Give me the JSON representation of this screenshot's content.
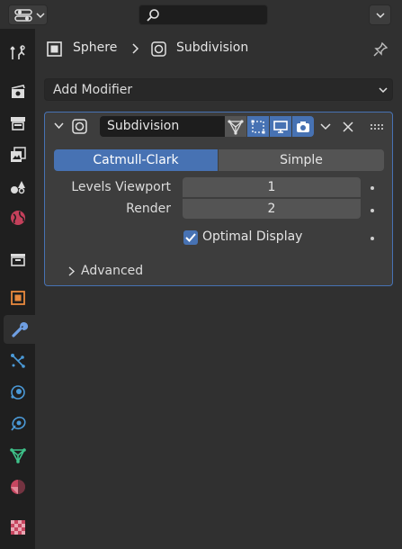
{
  "header": {
    "search_placeholder": ""
  },
  "breadcrumb": {
    "object": "Sphere",
    "modifier": "Subdivision"
  },
  "add_modifier": {
    "label": "Add Modifier"
  },
  "modifier": {
    "name": "Subdivision",
    "type_options": [
      "Catmull-Clark",
      "Simple"
    ],
    "selected_type": "Catmull-Clark",
    "levels_viewport_label": "Levels Viewport",
    "levels_viewport": "1",
    "render_label": "Render",
    "render": "2",
    "optimal_display_label": "Optimal Display",
    "optimal_display": true,
    "advanced_label": "Advanced"
  },
  "colors": {
    "accent": "#4772b3",
    "background": "#303030",
    "tab_bar": "#1f1f1f"
  },
  "tabs": [
    {
      "name": "tool",
      "icon": "tool-icon"
    },
    {
      "name": "render",
      "icon": "render-icon"
    },
    {
      "name": "output",
      "icon": "output-icon"
    },
    {
      "name": "view-layer",
      "icon": "view-layer-icon"
    },
    {
      "name": "scene",
      "icon": "scene-icon"
    },
    {
      "name": "world",
      "icon": "world-icon"
    },
    {
      "name": "collection",
      "icon": "collection-icon"
    },
    {
      "name": "object",
      "icon": "object-icon"
    },
    {
      "name": "modifiers",
      "icon": "wrench-icon",
      "active": true
    },
    {
      "name": "particles",
      "icon": "particles-icon"
    },
    {
      "name": "physics",
      "icon": "physics-icon"
    },
    {
      "name": "constraints",
      "icon": "constraints-icon"
    },
    {
      "name": "data",
      "icon": "mesh-data-icon"
    },
    {
      "name": "material",
      "icon": "material-icon"
    },
    {
      "name": "texture",
      "icon": "texture-icon"
    }
  ]
}
